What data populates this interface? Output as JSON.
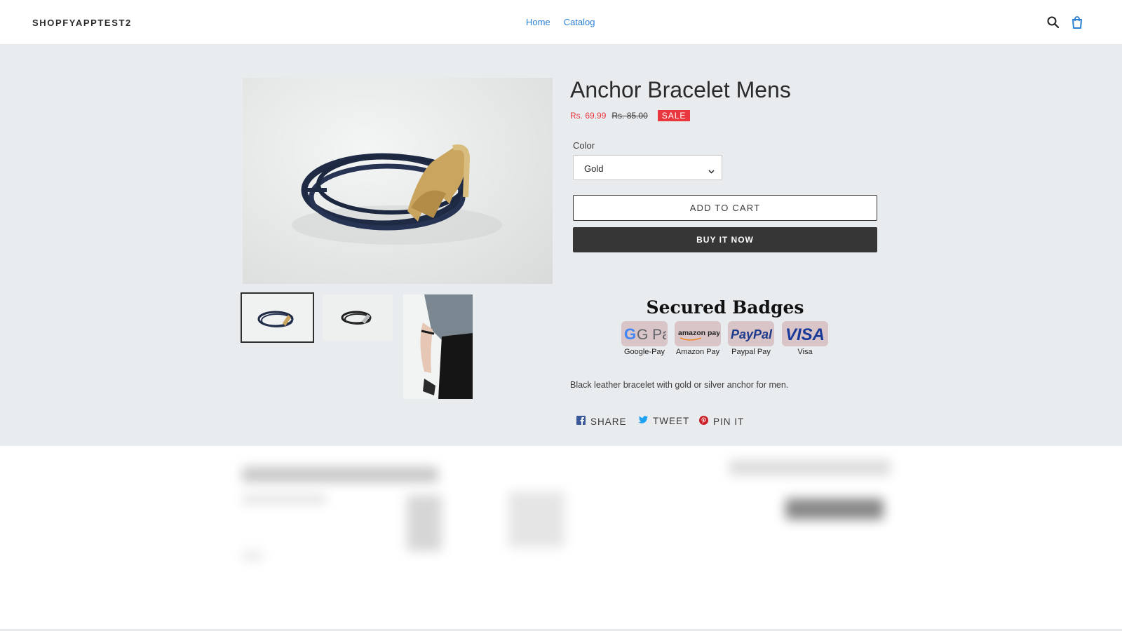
{
  "header": {
    "store_name": "SHOPFYAPPTEST2",
    "nav": [
      {
        "label": "Home"
      },
      {
        "label": "Catalog"
      }
    ],
    "search_icon": "search-icon",
    "cart_icon": "cart-icon"
  },
  "product": {
    "title": "Anchor Bracelet Mens",
    "price_sale": "Rs. 69.99",
    "price_original": "Rs. 85.00",
    "sale_badge": "SALE",
    "option_label": "Color",
    "option_selected": "Gold",
    "add_to_cart": "ADD TO CART",
    "buy_now": "BUY IT NOW",
    "description": "Black leather bracelet with gold or silver anchor for men."
  },
  "badges": {
    "title": "Secured Badges",
    "items": [
      {
        "logo": "G Pay",
        "caption": "Google-Pay"
      },
      {
        "logo": "amazon pay",
        "caption": "Amazon Pay"
      },
      {
        "logo": "PayPal",
        "caption": "Paypal Pay"
      },
      {
        "logo": "VISA",
        "caption": "Visa"
      }
    ]
  },
  "share": {
    "facebook": "SHARE",
    "twitter": "TWEET",
    "pinterest": "PIN IT"
  },
  "colors": {
    "accent_link": "#2a7fd4",
    "sale_red": "#e8373f",
    "band_bg": "#e9ecef",
    "buy_button": "#363636"
  }
}
